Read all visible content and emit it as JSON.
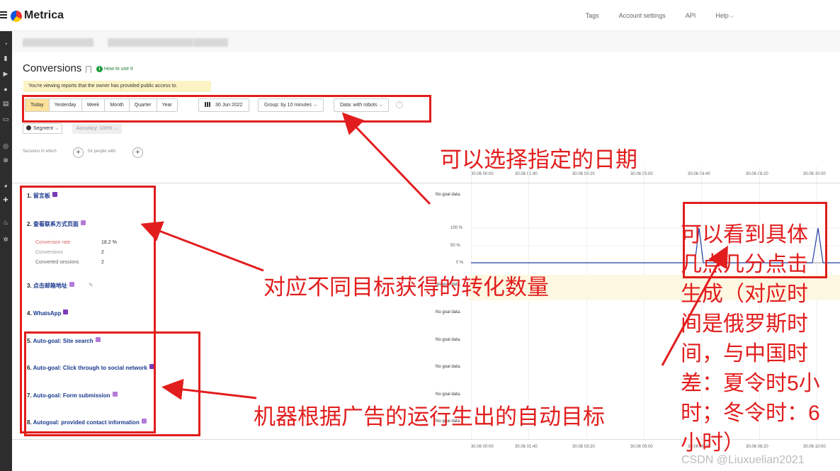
{
  "header": {
    "app_name": "Metrica",
    "nav": [
      "Tags",
      "Account settings",
      "API",
      "Help"
    ]
  },
  "page": {
    "title": "Conversions",
    "how_to": "How to use it",
    "notice": "You're viewing reports that the owner has provided public access to."
  },
  "toolbar": {
    "periods": [
      "Today",
      "Yesterday",
      "Week",
      "Month",
      "Quarter",
      "Year"
    ],
    "active_period": "Today",
    "date": "30 Jun 2022",
    "group": "Group: by 10 minutes",
    "data": "Data: with robots",
    "segment": "Segment",
    "accuracy": "Accuracy: 100%",
    "sessions_in_which": "Sessions in which",
    "for_people_with": "for people with"
  },
  "axis": {
    "ticks": [
      "30.06 00:00",
      "30.06 01:40",
      "30.06 03:20",
      "30.06 05:00",
      "30.06 06:40",
      "30.06 08:20",
      "30.06 10:00"
    ]
  },
  "chart_pct": [
    "100 %",
    "50 %",
    "0 %"
  ],
  "goals": [
    {
      "num": "1.",
      "name": "留言板",
      "status": "No goal data."
    },
    {
      "num": "2.",
      "name": "查看联系方式页面",
      "status": ""
    },
    {
      "num": "3.",
      "name": "点击邮箱地址",
      "status": "No goal data."
    },
    {
      "num": "4.",
      "name": "WhatsApp",
      "status": "No goal data."
    },
    {
      "num": "5.",
      "name": "Auto-goal: Site search",
      "status": "No goal data."
    },
    {
      "num": "6.",
      "name": "Auto-goal: Click through to social network",
      "status": "No goal data."
    },
    {
      "num": "7.",
      "name": "Auto-goal: Form submission",
      "status": "No goal data."
    },
    {
      "num": "8.",
      "name": "Autogoal: provided contact information",
      "status": "No goal data."
    }
  ],
  "goal2_stats": [
    {
      "label": "Conversion rate",
      "value": "18.2 %"
    },
    {
      "label": "Conversions",
      "value": "2"
    },
    {
      "label": "Converted sessions",
      "value": "2"
    }
  ],
  "annotations": {
    "date": "可以选择指定的日期",
    "counts": "对应不同目标获得的转化数量",
    "auto": "机器根据广告的运行生出的自动目标",
    "time": [
      "可以看到具体",
      "几点几分点击",
      "生成（对应时",
      "间是俄罗斯时",
      "间，与中国时",
      "差：夏令时5小",
      "时；冬令时：6",
      "小时）"
    ]
  },
  "watermark": "CSDN @Liuxuelian2021",
  "colors": {
    "annotation": "#e21d1d",
    "active_period": "#fde29b",
    "link": "#1a3a8e",
    "chart_line": "#1f3fa0"
  }
}
